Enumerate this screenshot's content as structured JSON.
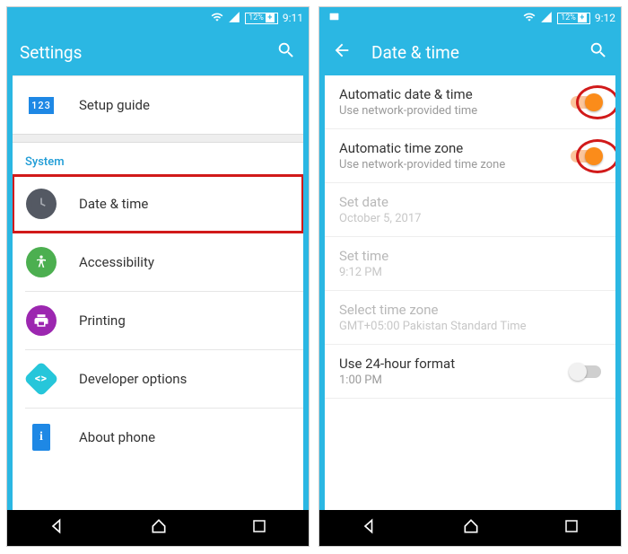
{
  "left": {
    "status": {
      "battery": "12%",
      "time": "9:11"
    },
    "appbar": {
      "title": "Settings"
    },
    "setup_guide": {
      "label": "Setup guide",
      "icon_text": "123"
    },
    "system_header": "System",
    "items": {
      "date_time": {
        "label": "Date & time"
      },
      "accessibility": {
        "label": "Accessibility"
      },
      "printing": {
        "label": "Printing"
      },
      "developer": {
        "label": "Developer options"
      },
      "about": {
        "label": "About phone"
      }
    }
  },
  "right": {
    "status": {
      "battery": "12%",
      "time": "9:12"
    },
    "appbar": {
      "title": "Date & time"
    },
    "rows": {
      "auto_date": {
        "title": "Automatic date & time",
        "sub": "Use network-provided time",
        "on": true
      },
      "auto_zone": {
        "title": "Automatic time zone",
        "sub": "Use network-provided time zone",
        "on": true
      },
      "set_date": {
        "title": "Set date",
        "sub": "October 5, 2017"
      },
      "set_time": {
        "title": "Set time",
        "sub": "9:12 PM"
      },
      "select_zone": {
        "title": "Select time zone",
        "sub": "GMT+05:00 Pakistan Standard Time"
      },
      "use_24h": {
        "title": "Use 24-hour format",
        "sub": "1:00 PM",
        "on": false
      }
    }
  }
}
